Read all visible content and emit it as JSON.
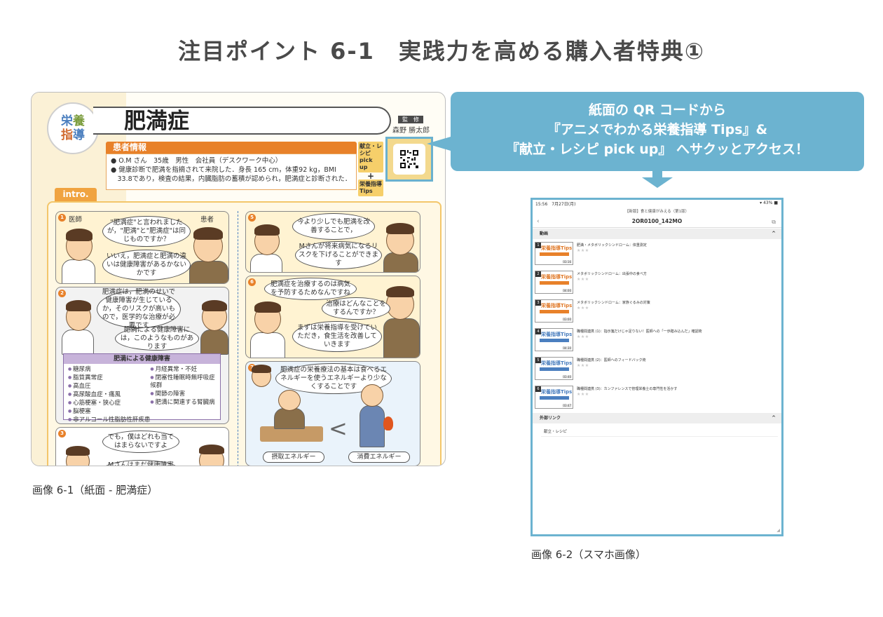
{
  "title": "注目ポイント 6-1　実践力を高める購入者特典①",
  "magazine": {
    "logo": {
      "l1": "栄",
      "l2": "養",
      "l3": "指",
      "l4": "導"
    },
    "page_title": "肥満症",
    "supervisor_label": "監　修",
    "supervisor_name": "森野 勝太郎",
    "patient_header": "患者情報",
    "patient_lines": [
      "● O.M さん　35歳　男性　会社員（デスクワーク中心）",
      "● 健康診断で肥満を指摘されて来院した．身長 165 cm，体重92 kg，BMI",
      "　33.8であり，検査の結果，内臓脂肪の蓄積が認められ，肥満症と診断された．"
    ],
    "side_label_top": "献立・レシピ pick up",
    "side_label_plus": "+",
    "side_label_bottom": "栄養指導 Tips",
    "intro_tag": "intro.",
    "panel_nums": [
      "1",
      "2",
      "3",
      "5",
      "6",
      "7"
    ],
    "panel1": {
      "role_left": "医師",
      "role_right": "患者",
      "bubble_a": "\"肥満症\"と言われましたが，\"肥満\"と\"肥満症\"は同じものですか？",
      "bubble_b": "いいえ，肥満症と肥満の違いは健康障害があるかないかです"
    },
    "panel2": {
      "bubble_a": "肥満症は，肥満のせいで健康障害が生じているか，そのリスクが高いもので，医学的な治療が必要です",
      "bubble_b": "肥満による健康障害には，このようなものがあります"
    },
    "disease_box": {
      "header": "肥満による健康障害",
      "col1": [
        "糖尿病",
        "脂質異常症",
        "高血圧",
        "高尿酸血症・痛風",
        "心筋梗塞・狭心症",
        "脳梗塞",
        "非アルコール性脂肪性肝疾患"
      ],
      "col2": [
        "月経異常・不妊",
        "閉塞性睡眠時無呼吸症候群",
        "関節の障害",
        "肥満に関連する腎臓病"
      ]
    },
    "panel3": {
      "bubble_a": "でも，僕はどれも当てはまらないですよ",
      "bubble_b": "Mさんはまだ健康障害は"
    },
    "panel5": {
      "bubble_a": "今より少しでも肥満を改善することで，",
      "bubble_b": "Mさんが将来病気になるリスクを下げることができます"
    },
    "panel6": {
      "bubble_a": "肥満症を治療するのは病気を予防するためなんですね",
      "bubble_b": "治療はどんなことをするんですか？",
      "bubble_c": "まずは栄養指導を受けていただき，食生活を改善していきます"
    },
    "panel7": {
      "bubble_a": "肥満症の栄養療法の基本は食べるエネルギーを使うエネルギーより少なくすることです",
      "label_intake": "摂取エネルギー",
      "label_burn": "消費エネルギー"
    }
  },
  "caption_left": "画像 6-1（紙面 - 肥満症）",
  "callout": {
    "line1": "紙面の QR コードから",
    "line2": "『アニメでわかる栄養指導 Tips』&",
    "line3": "『献立・レシピ pick up』 へサクッとアクセス！"
  },
  "tablet": {
    "status_time": "15:56　7月27日(月)",
    "status_right": "▾ 43% ■",
    "nav_sub": "【新版】食と健康がみえる（第1版）",
    "nav_title": "2OR0100_142MO",
    "nav_back": "‹",
    "nav_copy": "⧉",
    "section_video": "動画",
    "section_links": "外部リンク",
    "chevron": "^",
    "videos": [
      {
        "num": "1",
        "title": "肥満・メタボリックシンドローム：体重測定",
        "stars": "★★★",
        "thumb": "栄養指導Tips",
        "dur": "03:16"
      },
      {
        "num": "2",
        "title": "メタボリックシンドローム：出張中の食べ方",
        "stars": "★★★",
        "thumb": "栄養指導Tips",
        "dur": "04:00"
      },
      {
        "num": "3",
        "title": "メタボリックシンドローム：家族ぐるみの対策",
        "stars": "★★★",
        "thumb": "栄養指導Tips",
        "dur": "03:00"
      },
      {
        "num": "4",
        "title": "職種間連携 (1)：指示箋だけじゃ足りない！医師への「一歩踏み込んだ」確認術",
        "stars": "★★★",
        "thumb": "栄養指導Tips",
        "dur": "04:30"
      },
      {
        "num": "5",
        "title": "職種間連携 (2)：医師へのフィードバック術",
        "stars": "★★★",
        "thumb": "栄養指導Tips",
        "dur": "03:40"
      },
      {
        "num": "6",
        "title": "職種間連携 (3)：カンファレンスで管理栄養士の専門性を活かす",
        "stars": "★★★",
        "thumb": "栄養指導Tips",
        "dur": "03:47"
      }
    ],
    "link_item": "献立・レシピ"
  },
  "caption_right": "画像 6-2（スマホ画像）",
  "colors": {
    "accent_blue": "#6cb3d0",
    "accent_orange": "#e8812a",
    "title_gray": "#4a4a4a"
  }
}
